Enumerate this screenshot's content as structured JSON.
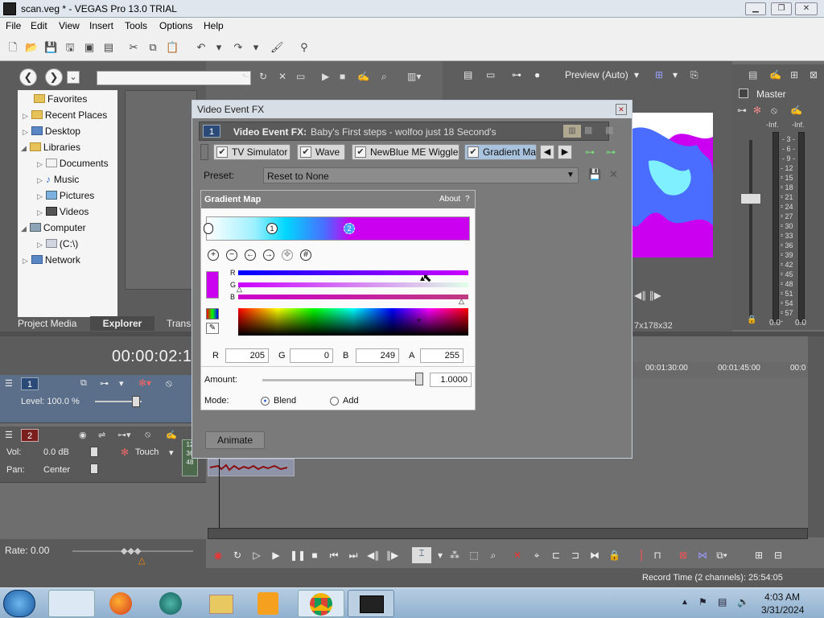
{
  "window": {
    "title": "scan.veg * - VEGAS Pro 13.0 TRIAL"
  },
  "menu": [
    "File",
    "Edit",
    "View",
    "Insert",
    "Tools",
    "Options",
    "Help"
  ],
  "explorer": {
    "tree": [
      {
        "label": "Favorites",
        "indent": 1,
        "icon": "folder-icon"
      },
      {
        "label": "Recent Places",
        "indent": 1,
        "icon": "folder-icon"
      },
      {
        "label": "Desktop",
        "indent": 0,
        "icon": "desktop-icon"
      },
      {
        "label": "Libraries",
        "indent": 0,
        "icon": "folder-icon"
      },
      {
        "label": "Documents",
        "indent": 2,
        "icon": "documents-icon"
      },
      {
        "label": "Music",
        "indent": 2,
        "icon": "music-icon"
      },
      {
        "label": "Pictures",
        "indent": 2,
        "icon": "pictures-icon"
      },
      {
        "label": "Videos",
        "indent": 2,
        "icon": "videos-icon"
      },
      {
        "label": "Computer",
        "indent": 0,
        "icon": "computer-icon"
      },
      {
        "label": "(C:\\)",
        "indent": 2,
        "icon": "drive-icon"
      },
      {
        "label": "Network",
        "indent": 0,
        "icon": "network-icon"
      }
    ],
    "tabs": [
      "Project Media",
      "Explorer",
      "Transi"
    ]
  },
  "timeline": {
    "timecode": "00:00:02:1",
    "ruler": [
      "00:01:30:00",
      "00:01:45:00",
      "00:0"
    ],
    "track1": {
      "num": "1",
      "level": "Level: 100.0 %"
    },
    "track2": {
      "num": "2",
      "vol_label": "Vol:",
      "vol": "0.0 dB",
      "pan_label": "Pan:",
      "pan": "Center",
      "touch": "Touch"
    },
    "rate": "Rate: 0.00"
  },
  "dialog": {
    "title": "Video Event FX",
    "header_label": "Video Event FX:",
    "header_value": "Baby's First steps - wolfoo  just 18 Second's",
    "track_num": "1",
    "chain": [
      "TV Simulator",
      "Wave",
      "NewBlue ME Wiggle",
      "Gradient Ma"
    ],
    "preset_label": "Preset:",
    "preset_value": "Reset to None",
    "gradient_map": {
      "title": "Gradient Map",
      "about": "About",
      "help": "?",
      "channel_labels": [
        "R",
        "G",
        "B"
      ],
      "r_label": "R",
      "r": "205",
      "g_label": "G",
      "g": "0",
      "b_label": "B",
      "b": "249",
      "a_label": "A",
      "a": "255",
      "amount_label": "Amount:",
      "amount": "1.0000",
      "amount_fraction": 1.0,
      "mode_label": "Mode:",
      "mode_blend": "Blend",
      "mode_add": "Add",
      "mode_selected": "Blend",
      "stop1": "1",
      "stop2": "2"
    },
    "animate": "Animate"
  },
  "preview": {
    "label": "Preview (Auto)",
    "resolution": "7x178x32"
  },
  "master": {
    "label": "Master",
    "inf_left": "-Inf.",
    "inf_right": "-Inf.",
    "scale": [
      "3",
      "6",
      "9",
      "12",
      "15",
      "18",
      "21",
      "24",
      "27",
      "30",
      "33",
      "36",
      "39",
      "42",
      "45",
      "48",
      "51",
      "54",
      "57"
    ],
    "val_left": "0.0",
    "val_right": "0.0"
  },
  "meter_marks": [
    "12",
    "36",
    "48"
  ],
  "status": {
    "record_time": "Record Time (2 channels): 25:54:05"
  },
  "taskbar": {
    "time": "4:03 AM",
    "date": "3/31/2024"
  },
  "colors": {
    "magenta": "#cc00f0",
    "cyan": "#7fe8ff",
    "dialog_bg": "#7a7a7a",
    "timeline_bg": "#6e6e6e"
  }
}
